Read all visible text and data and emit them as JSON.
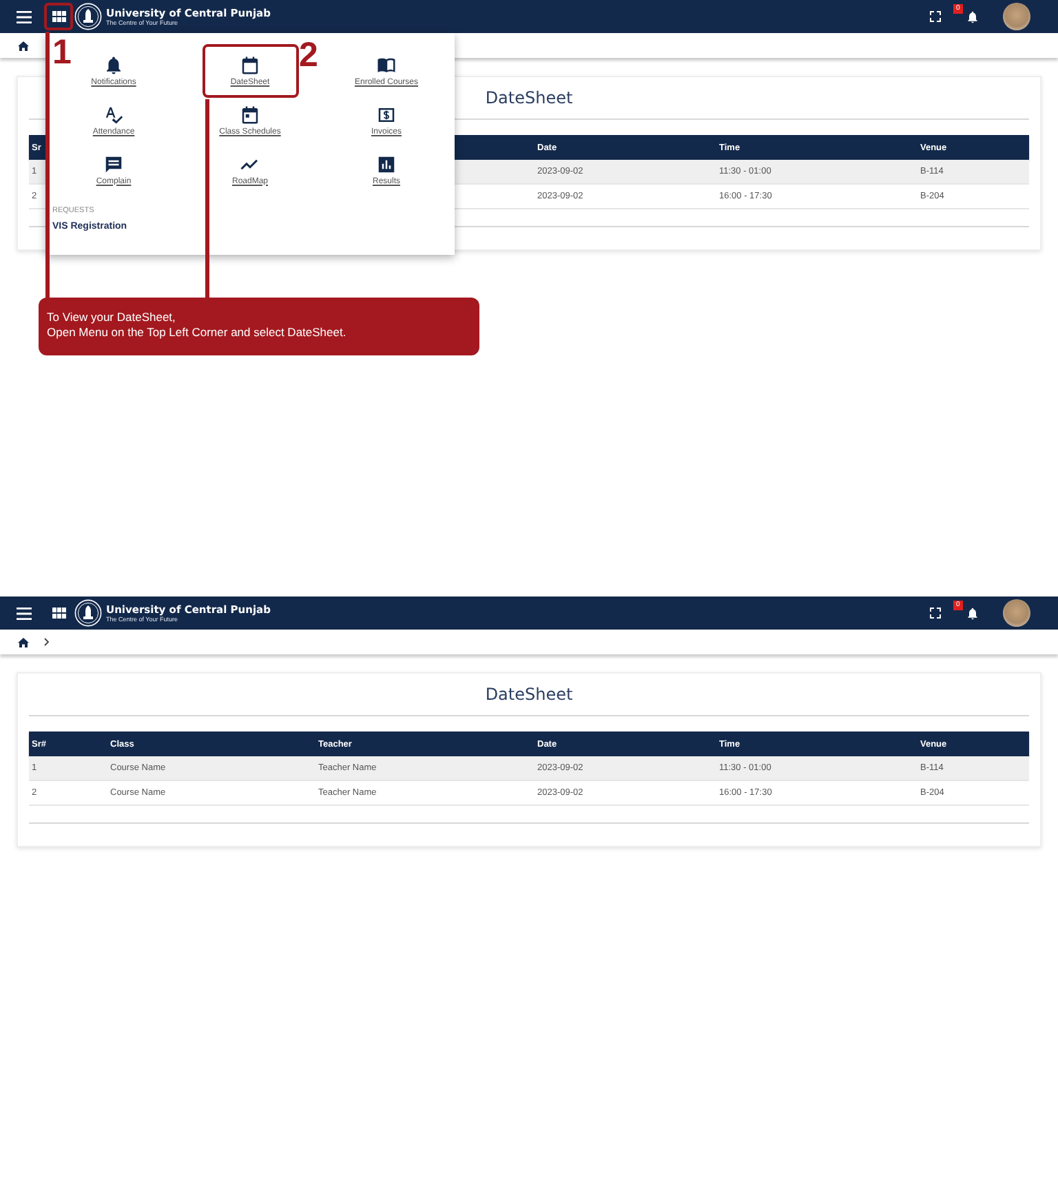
{
  "screens": [
    {
      "header": {
        "title": "University of Central Punjab",
        "subtitle": "The Centre of Your Future",
        "badge": "0",
        "menu_step": "1"
      },
      "breadcrumb": {
        "separator": false
      },
      "card": {
        "title": "DateSheet",
        "columns": [
          "Sr",
          "Date",
          "Time",
          "Venue"
        ],
        "rows": [
          [
            "1",
            "2023-09-02",
            "11:30 - 01:00",
            "B-114"
          ],
          [
            "2",
            "2023-09-02",
            "16:00 - 17:30",
            "B-204"
          ]
        ]
      },
      "menu": {
        "items": [
          {
            "label": "Notifications",
            "kind": "bell"
          },
          {
            "label": "DateSheet",
            "kind": "calendar",
            "step": "2"
          },
          {
            "label": "Enrolled Courses",
            "kind": "book"
          },
          {
            "label": "Attendance",
            "kind": "spellcheck"
          },
          {
            "label": "Class Schedules",
            "kind": "event"
          },
          {
            "label": "Invoices",
            "kind": "dollar"
          },
          {
            "label": "Complain",
            "kind": "chat"
          },
          {
            "label": "RoadMap",
            "kind": "trend"
          },
          {
            "label": "Results",
            "kind": "chart"
          }
        ],
        "section": "REQUESTS",
        "link": "VIS Registration"
      },
      "callout": "To View your DateSheet,\nOpen Menu on the Top Left Corner and select DateSheet."
    },
    {
      "header": {
        "title": "University of Central Punjab",
        "subtitle": "The Centre of Your Future",
        "badge": "0"
      },
      "breadcrumb": {
        "separator": true
      },
      "card": {
        "title": "DateSheet",
        "columns": [
          "Sr#",
          "Class",
          "Teacher",
          "Date",
          "Time",
          "Venue"
        ],
        "rows": [
          [
            "1",
            "Course Name",
            "Teacher Name",
            "2023-09-02",
            "11:30 - 01:00",
            "B-114"
          ],
          [
            "2",
            "Course Name",
            "Teacher Name",
            "2023-09-02",
            "16:00 - 17:30",
            "B-204"
          ]
        ]
      }
    }
  ]
}
